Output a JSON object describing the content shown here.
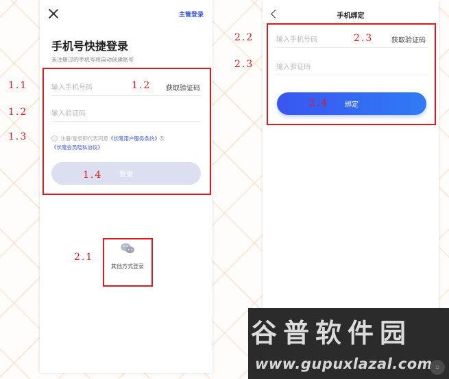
{
  "left_screen": {
    "manager_login": "主管登录",
    "title": "手机号快捷登录",
    "subtitle": "未注册过的手机号将自动创建账号",
    "phone_placeholder": "输入手机号码",
    "get_code": "获取验证码",
    "code_placeholder": "输入验证码",
    "agree_prefix": "注册/登录即代表同意",
    "agree_terms": "《长隆用户服务条约》",
    "agree_and": "及",
    "agree_privacy": "《长隆会员隐私协议》",
    "login_button": "登录",
    "other_login": "其他方式登录",
    "other_login_icon": "wechat-icon"
  },
  "right_screen": {
    "title": "手机绑定",
    "phone_placeholder": "输入手机号码",
    "get_code": "获取验证码",
    "code_placeholder": "输入验证码",
    "bind_button": "绑定"
  },
  "annotations": {
    "m1_1": "1.1",
    "m1_2": "1.2",
    "m1_3": "1.3",
    "m1_4": "1.4",
    "m2_1": "2.1",
    "m2_2": "2.2",
    "m2_3": "2.3",
    "m2_4": "2.4"
  },
  "watermark": {
    "cn": "谷普软件园",
    "en": "www.gupuxlazal.com"
  },
  "colors": {
    "accent": "#3a55e6",
    "annotation_red": "#e3181b",
    "disabled_button": "#dcdff0"
  }
}
